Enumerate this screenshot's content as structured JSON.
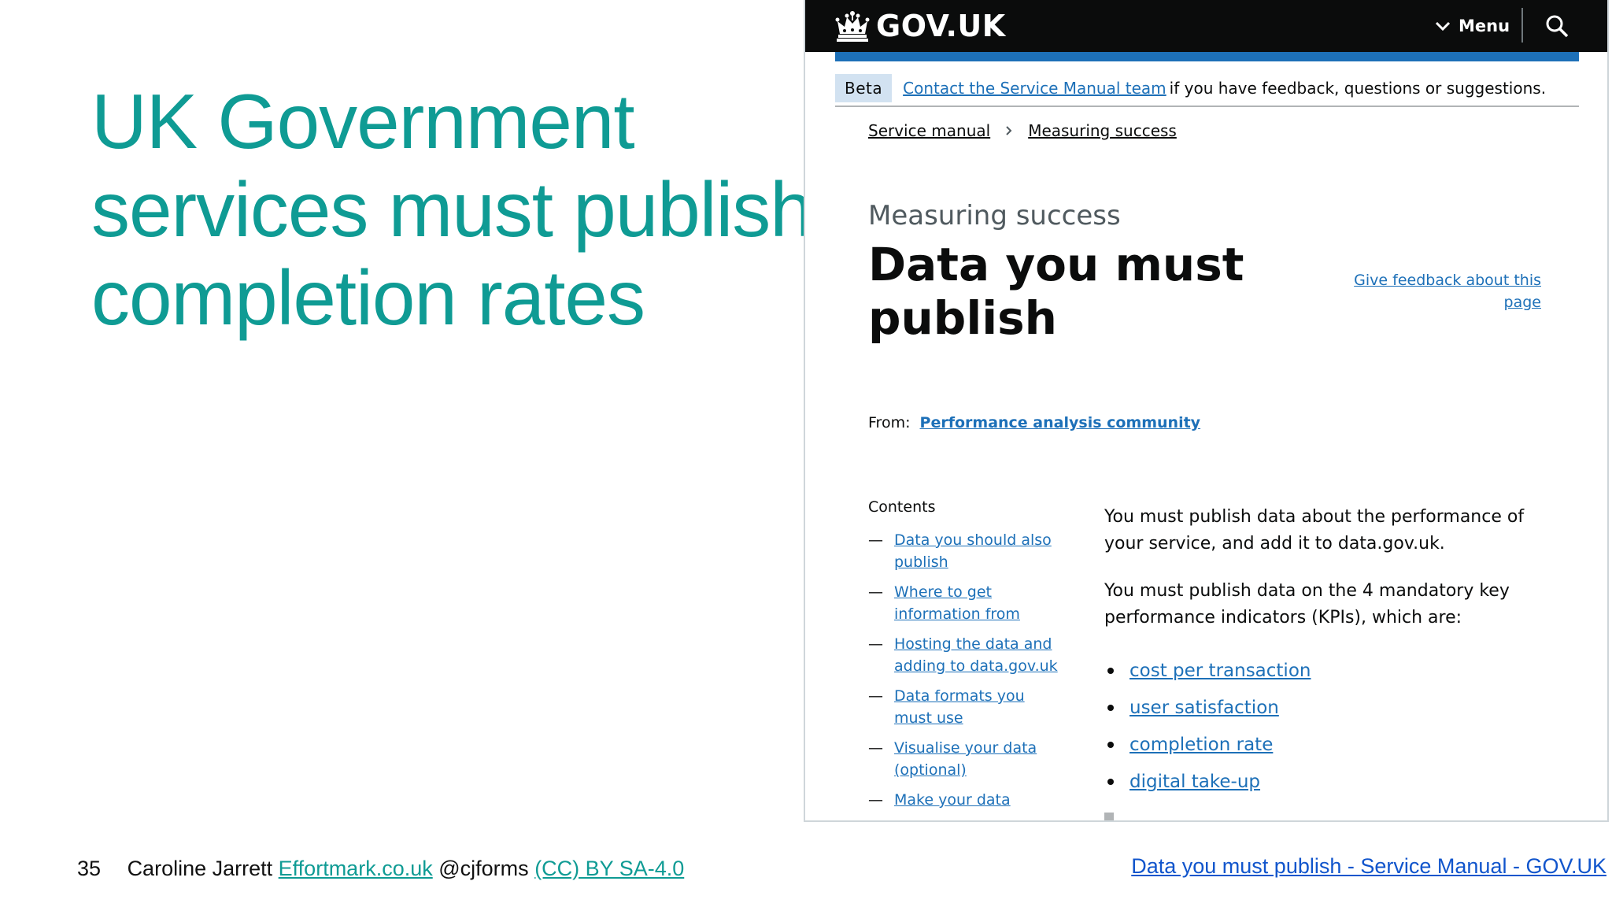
{
  "slide": {
    "title_lines": [
      "UK Government",
      "services must publish",
      "completion rates"
    ]
  },
  "footer": {
    "slide_number": "35",
    "author": "Caroline Jarrett",
    "site_link": "Effortmark.co.uk",
    "handle": "@cjforms",
    "license_link": "(CC) BY SA-4.0",
    "source_link": "Data you must publish - Service Manual - GOV.UK"
  },
  "govuk": {
    "logo_text": "GOV.UK",
    "menu_label": "Menu",
    "phase_tag": "Beta",
    "phase_link": "Contact the Service Manual team",
    "phase_text": "if you have feedback, questions or suggestions.",
    "breadcrumbs": [
      "Service manual",
      "Measuring success"
    ],
    "caption": "Measuring success",
    "heading": "Data you must publish",
    "feedback_link": "Give feedback about this page",
    "from_label": "From:",
    "from_link": "Performance analysis community",
    "contents_heading": "Contents",
    "contents": [
      "Data you should also publish",
      "Where to get information from",
      "Hosting the data and adding to data.gov.uk",
      "Data formats you must use",
      "Visualise your data (optional)",
      "Make your data"
    ],
    "paragraphs": [
      "You must publish data about the performance of your service, and add it to data.gov.uk.",
      "You must publish data on the 4 mandatory key performance indicators (KPIs), which are:"
    ],
    "kpis": [
      "cost per transaction",
      "user satisfaction",
      "completion rate",
      "digital take-up"
    ]
  },
  "colors": {
    "slide_title": "#0f9b94",
    "gov_header": "#0b0c0c",
    "gov_blue": "#1d70b8",
    "beta_tag": "#d2e2f1"
  },
  "icons": [
    "crown-icon",
    "chevron-down-icon",
    "search-icon"
  ]
}
